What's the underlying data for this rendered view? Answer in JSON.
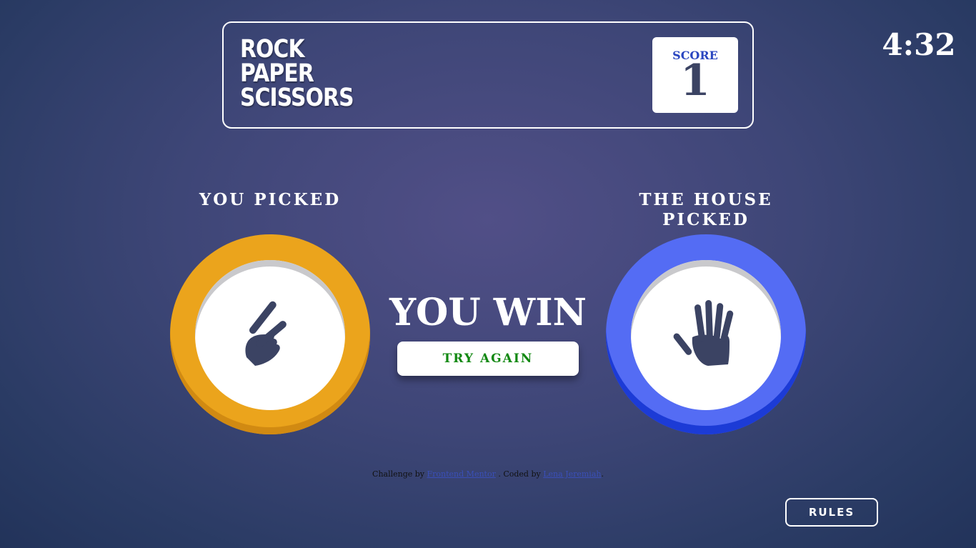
{
  "header": {
    "title_lines": [
      "ROCK",
      "PAPER",
      "SCISSORS"
    ],
    "score_label": "SCORE",
    "score_value": "1"
  },
  "timer": "4:32",
  "player": {
    "label": "YOU PICKED",
    "choice_icon": "scissors-icon",
    "ring_color": "#eba41c"
  },
  "house": {
    "label": "THE HOUSE PICKED",
    "choice_icon": "paper-icon",
    "ring_color": "#546cf4"
  },
  "result": {
    "text": "YOU WIN",
    "try_again_label": "TRY AGAIN"
  },
  "attribution": {
    "prefix": "Challenge by",
    "challenge_link": "Frontend Mentor",
    "middle": ". Coded by",
    "author_link": "Lena Jeremiah",
    "suffix": "."
  },
  "rules_label": "RULES"
}
